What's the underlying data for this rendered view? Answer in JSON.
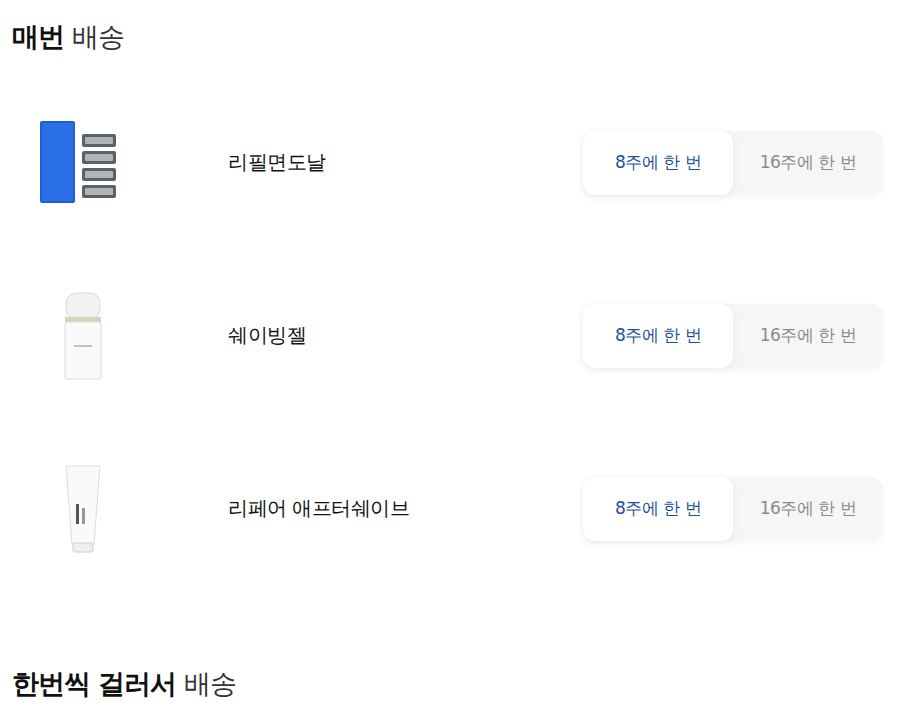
{
  "sections": [
    {
      "title_bold": "매번",
      "title_light": "배송",
      "items": [
        {
          "name": "리필면도날",
          "kind": "razor",
          "options": [
            {
              "label": "8주에 한 번",
              "selected": true
            },
            {
              "label": "16주에 한 번",
              "selected": false
            }
          ]
        },
        {
          "name": "쉐이빙젤",
          "kind": "bottle",
          "options": [
            {
              "label": "8주에 한 번",
              "selected": true
            },
            {
              "label": "16주에 한 번",
              "selected": false
            }
          ]
        },
        {
          "name": "리페어 애프터쉐이브",
          "kind": "tube",
          "options": [
            {
              "label": "8주에 한 번",
              "selected": true
            },
            {
              "label": "16주에 한 번",
              "selected": false
            }
          ]
        }
      ]
    },
    {
      "title_bold": "한번씩 걸러서",
      "title_light": "배송",
      "items": []
    }
  ]
}
